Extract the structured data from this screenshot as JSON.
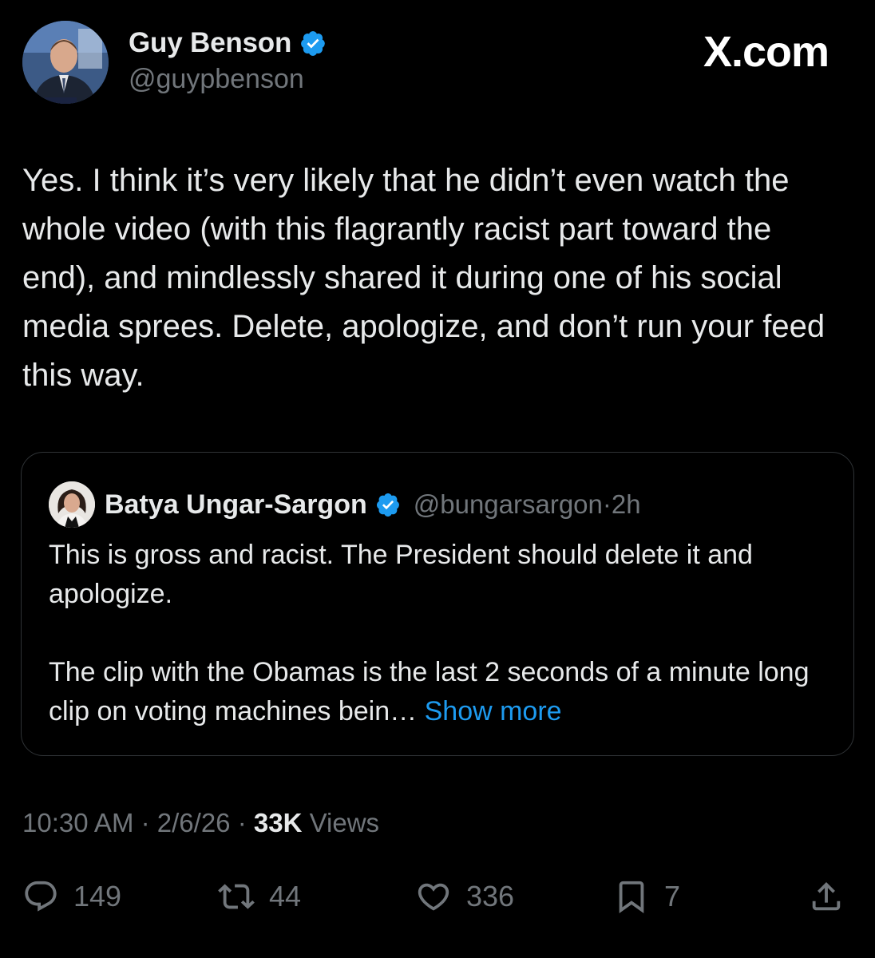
{
  "author": {
    "name": "Guy Benson",
    "handle": "@guypbenson"
  },
  "brand": "X.com",
  "tweet": {
    "text": "Yes. I think it’s very likely that he didn’t even watch the whole video (with this flagrantly racist part toward the end), and mindlessly shared it during one of his social media sprees. Delete, apologize, and don’t run your feed this way."
  },
  "quote": {
    "name": "Batya Ungar-Sargon",
    "handle": "@bungarsargon",
    "sep": "·",
    "time": "2h",
    "paragraph1": "This is gross and racist. The President should delete it and apologize.",
    "paragraph2": "The clip with the Obamas is the last 2 seconds of a minute long clip on voting machines bein…",
    "show_more": "Show more"
  },
  "meta": {
    "time": "10:30 AM",
    "sep": "·",
    "date": "2/6/26",
    "views_count": "33K",
    "views_label": "Views"
  },
  "actions": {
    "replies": "149",
    "reposts": "44",
    "likes": "336",
    "bookmarks": "7"
  },
  "colors": {
    "background": "#000000",
    "text": "#e7e9ea",
    "secondary": "#71767b",
    "accent": "#1d9bf0",
    "border": "#2f3336"
  },
  "icons": [
    "verified-badge-icon",
    "reply-icon",
    "repost-icon",
    "like-icon",
    "bookmark-icon",
    "share-icon"
  ]
}
